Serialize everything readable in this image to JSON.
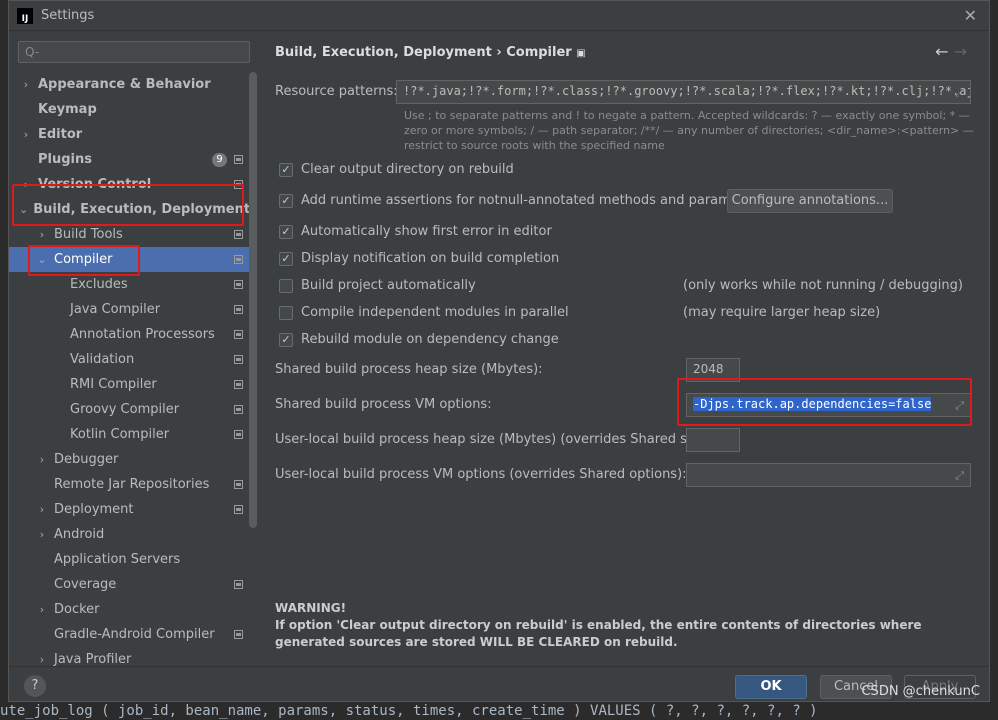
{
  "window": {
    "title": "Settings",
    "logo": "IJ"
  },
  "search": {
    "placeholder": "Q-"
  },
  "sidebar": {
    "items": [
      {
        "label": "Appearance & Behavior",
        "level": 0,
        "arrow": "›",
        "bold": true
      },
      {
        "label": "Keymap",
        "level": 0,
        "arrow": "",
        "bold": true
      },
      {
        "label": "Editor",
        "level": 0,
        "arrow": "›",
        "bold": true
      },
      {
        "label": "Plugins",
        "level": 0,
        "arrow": "",
        "bold": true,
        "badge": "9",
        "proj": true
      },
      {
        "label": "Version Control",
        "level": 0,
        "arrow": "›",
        "bold": true,
        "proj": true
      },
      {
        "label": "Build, Execution, Deployment",
        "level": 0,
        "arrow": "⌄",
        "bold": true
      },
      {
        "label": "Build Tools",
        "level": 1,
        "arrow": "›",
        "proj": true
      },
      {
        "label": "Compiler",
        "level": 1,
        "arrow": "⌄",
        "proj": true,
        "selected": true
      },
      {
        "label": "Excludes",
        "level": 2,
        "arrow": "",
        "proj": true
      },
      {
        "label": "Java Compiler",
        "level": 2,
        "arrow": "",
        "proj": true
      },
      {
        "label": "Annotation Processors",
        "level": 2,
        "arrow": "",
        "proj": true
      },
      {
        "label": "Validation",
        "level": 2,
        "arrow": "",
        "proj": true
      },
      {
        "label": "RMI Compiler",
        "level": 2,
        "arrow": "",
        "proj": true
      },
      {
        "label": "Groovy Compiler",
        "level": 2,
        "arrow": "",
        "proj": true
      },
      {
        "label": "Kotlin Compiler",
        "level": 2,
        "arrow": "",
        "proj": true
      },
      {
        "label": "Debugger",
        "level": 1,
        "arrow": "›"
      },
      {
        "label": "Remote Jar Repositories",
        "level": 1,
        "arrow": "",
        "proj": true
      },
      {
        "label": "Deployment",
        "level": 1,
        "arrow": "›",
        "proj": true
      },
      {
        "label": "Android",
        "level": 1,
        "arrow": "›"
      },
      {
        "label": "Application Servers",
        "level": 1,
        "arrow": ""
      },
      {
        "label": "Coverage",
        "level": 1,
        "arrow": "",
        "proj": true
      },
      {
        "label": "Docker",
        "level": 1,
        "arrow": "›"
      },
      {
        "label": "Gradle-Android Compiler",
        "level": 1,
        "arrow": "",
        "proj": true
      },
      {
        "label": "Java Profiler",
        "level": 1,
        "arrow": "›"
      }
    ]
  },
  "main": {
    "breadcrumb": "Build, Execution, Deployment  ›  Compiler",
    "resource_label": "Resource patterns:",
    "resource_value": "!?*.java;!?*.form;!?*.class;!?*.groovy;!?*.scala;!?*.flex;!?*.kt;!?*.clj;!?*.aj",
    "help": "Use ; to separate patterns and ! to negate a pattern. Accepted wildcards: ? — exactly one symbol; * — zero or more symbols; / — path separator; /**/ — any number of directories; <dir_name>:<pattern> — restrict to source roots with the specified name",
    "checkboxes": [
      {
        "label": "Clear output directory on rebuild",
        "checked": true
      },
      {
        "label": "Add runtime assertions for notnull-annotated methods and parameters",
        "checked": true
      },
      {
        "label": "Automatically show first error in editor",
        "checked": true
      },
      {
        "label": "Display notification on build completion",
        "checked": true
      },
      {
        "label": "Build project automatically",
        "checked": false,
        "note": "(only works while not running / debugging)"
      },
      {
        "label": "Compile independent modules in parallel",
        "checked": false,
        "note": "(may require larger heap size)"
      },
      {
        "label": "Rebuild module on dependency change",
        "checked": true
      }
    ],
    "configure_btn": "Configure annotations...",
    "heap_label": "Shared build process heap size (Mbytes):",
    "heap_value": "2048",
    "vm_label": "Shared build process VM options:",
    "vm_value": "-Djps.track.ap.dependencies=false",
    "local_heap_label": "User-local build process heap size (Mbytes) (overrides Shared size):",
    "local_heap_value": "",
    "local_vm_label": "User-local build process VM options (overrides Shared options):",
    "local_vm_value": "",
    "warning_title": "WARNING!",
    "warning_text": "If option 'Clear output directory on rebuild' is enabled, the entire contents of directories where generated sources are stored WILL BE CLEARED on rebuild."
  },
  "footer": {
    "help": "?",
    "ok": "OK",
    "cancel": "Cancel",
    "apply": "Apply"
  },
  "background_code": "ute_job_log ( job_id, bean_name, params, status, times, create_time ) VALUES ( ?, ?, ?, ?, ?, ? )",
  "watermark": "CSDN @chenkunC",
  "colors": {
    "accent": "#4b6eaf",
    "highlight": "#e0191d"
  }
}
